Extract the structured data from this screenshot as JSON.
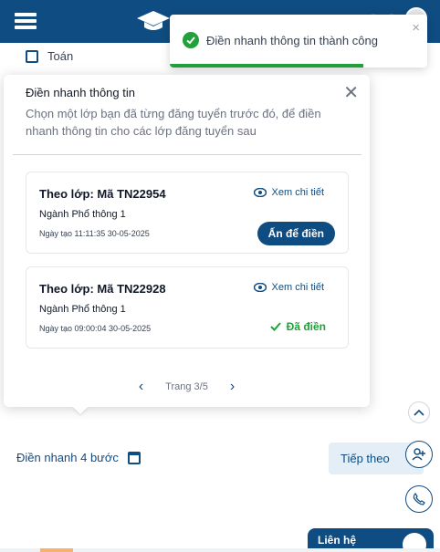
{
  "filter": {
    "checkbox_label": "Toán"
  },
  "toast": {
    "message": "Điền nhanh thông tin thành công",
    "close_glyph": "×",
    "progress": 0.75
  },
  "popover": {
    "title": "Điền nhanh thông tin",
    "description": "Chọn một lớp bạn đã từng đăng tuyển trước đó, để điền nhanh thông tin cho các lớp đăng tuyển sau",
    "close_glyph": "✕",
    "cards": [
      {
        "title": "Theo lớp: Mã TN22954",
        "major": "Ngành Phổ thông 1",
        "date": "Ngày tạo 11:11:35 30-05-2025",
        "view_label": "Xem chi tiết",
        "action_label": "Ấn để điền",
        "state": "action"
      },
      {
        "title": "Theo lớp: Mã TN22928",
        "major": "Ngành Phổ thông 1",
        "date": "Ngày tạo 09:00:04 30-05-2025",
        "view_label": "Xem chi tiết",
        "status_label": "Đã điền",
        "state": "filled"
      }
    ],
    "pager": {
      "text": "Trang 3/5",
      "prev_glyph": "‹",
      "next_glyph": "›"
    }
  },
  "footer": {
    "quick_fill_label": "Điền nhanh 4 bước",
    "next_label": "Tiếp theo"
  },
  "contact": {
    "label": "Liên hệ"
  },
  "colors": {
    "primary": "#0f4c81",
    "success": "#22a03a",
    "danger": "#e11d48",
    "accent_tab": "#f6b26b"
  },
  "icons": [
    "menu-icon",
    "graduation-cap-icon",
    "notification-icon",
    "cart-icon",
    "avatar",
    "check-circle-icon",
    "close-icon",
    "eye-icon",
    "check-icon",
    "chevron-left-icon",
    "chevron-right-icon",
    "calendar-icon",
    "arrow-right-icon",
    "chevron-up-icon",
    "add-user-icon",
    "phone-icon",
    "headset-icon"
  ]
}
